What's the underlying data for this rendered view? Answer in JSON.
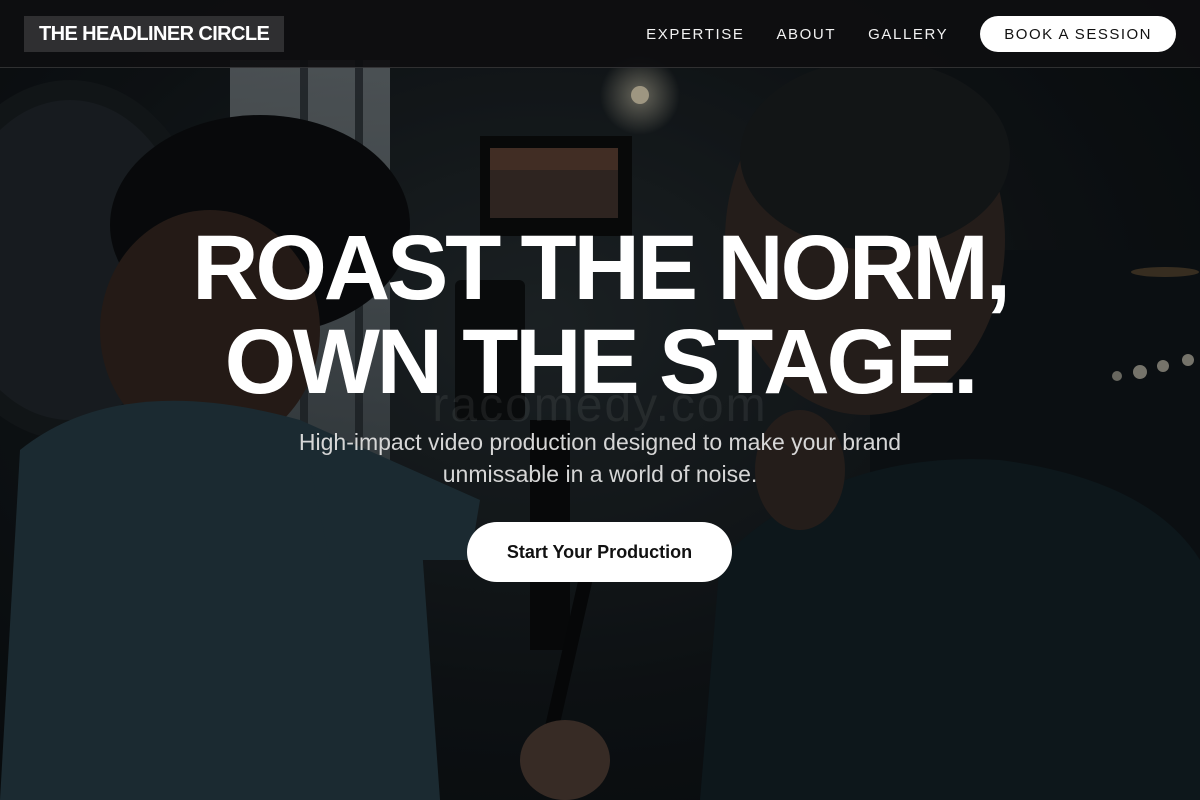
{
  "brand": {
    "name": "THE HEADLINER CIRCLE"
  },
  "nav": {
    "links": [
      "EXPERTISE",
      "ABOUT",
      "GALLERY"
    ],
    "cta_label": "BOOK A SESSION"
  },
  "hero": {
    "headline_line1": "ROAST THE NORM,",
    "headline_line2": "OWN THE STAGE.",
    "watermark": "racomedy.com",
    "subtitle": "High-impact video production designed to make your brand unmissable in a world of noise.",
    "cta_label": "Start Your Production",
    "background_image": "two-men-filming-with-camera-rig-in-dark-bar"
  },
  "colors": {
    "nav_bg": "#0e0e10",
    "brand_bg": "#2f2f31",
    "button_bg": "#ffffff",
    "button_text": "#111111",
    "headline": "#ffffff",
    "subtitle": "#d6d6d6"
  }
}
